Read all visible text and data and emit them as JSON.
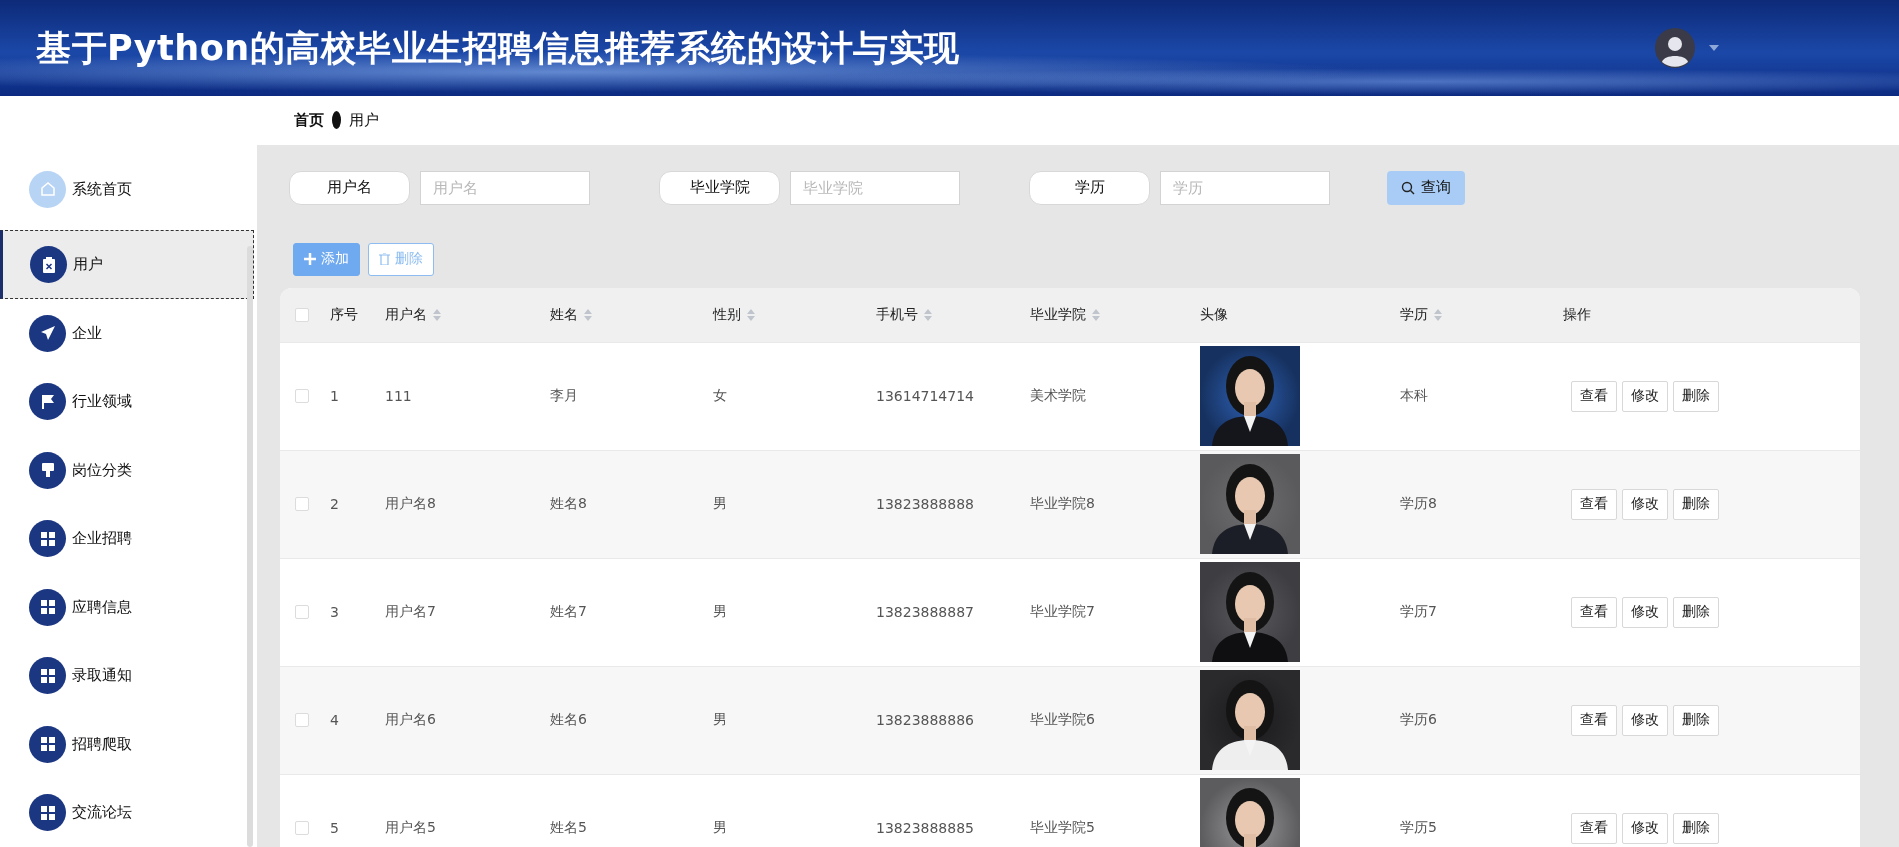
{
  "header": {
    "title": "基于Python的高校毕业生招聘信息推荐系统的设计与实现"
  },
  "breadcrumb": [
    "首页",
    "用户"
  ],
  "sidebar": {
    "items": [
      {
        "label": "系统首页",
        "kind": "home",
        "selected": false
      },
      {
        "label": "用户",
        "kind": "clipboard",
        "selected": true
      },
      {
        "label": "企业",
        "kind": "plane",
        "selected": false
      },
      {
        "label": "行业领域",
        "kind": "flag",
        "selected": false
      },
      {
        "label": "岗位分类",
        "kind": "brush",
        "selected": false
      },
      {
        "label": "企业招聘",
        "kind": "grid",
        "selected": false
      },
      {
        "label": "应聘信息",
        "kind": "grid",
        "selected": false
      },
      {
        "label": "录取通知",
        "kind": "grid",
        "selected": false
      },
      {
        "label": "招聘爬取",
        "kind": "grid",
        "selected": false
      },
      {
        "label": "交流论坛",
        "kind": "grid",
        "selected": false
      }
    ]
  },
  "search": {
    "fields": [
      {
        "label": "用户名",
        "placeholder": "用户名"
      },
      {
        "label": "毕业学院",
        "placeholder": "毕业学院"
      },
      {
        "label": "学历",
        "placeholder": "学历"
      }
    ],
    "button": "查询"
  },
  "actions": [
    {
      "label": "添加",
      "kind": "add"
    },
    {
      "label": "删除",
      "kind": "delete"
    }
  ],
  "table": {
    "header_checked": false,
    "columns": [
      {
        "label": "序号",
        "sortable": false
      },
      {
        "label": "用户名",
        "sortable": true
      },
      {
        "label": "姓名",
        "sortable": true
      },
      {
        "label": "性别",
        "sortable": true
      },
      {
        "label": "手机号",
        "sortable": true
      },
      {
        "label": "毕业学院",
        "sortable": true
      },
      {
        "label": "头像",
        "sortable": false
      },
      {
        "label": "学历",
        "sortable": true
      },
      {
        "label": "操作",
        "sortable": false
      }
    ],
    "rows": [
      {
        "checked": false,
        "cells": [
          "1",
          "111",
          "李月",
          "女",
          "13614714714",
          "美术学院",
          "本科"
        ],
        "actions": [
          "查看",
          "修改",
          "删除"
        ]
      },
      {
        "checked": false,
        "cells": [
          "2",
          "用户名8",
          "姓名8",
          "男",
          "13823888888",
          "毕业学院8",
          "学历8"
        ],
        "actions": [
          "查看",
          "修改",
          "删除"
        ]
      },
      {
        "checked": false,
        "cells": [
          "3",
          "用户名7",
          "姓名7",
          "男",
          "13823888887",
          "毕业学院7",
          "学历7"
        ],
        "actions": [
          "查看",
          "修改",
          "删除"
        ]
      },
      {
        "checked": false,
        "cells": [
          "4",
          "用户名6",
          "姓名6",
          "男",
          "13823888886",
          "毕业学院6",
          "学历6"
        ],
        "actions": [
          "查看",
          "修改",
          "删除"
        ]
      },
      {
        "checked": false,
        "cells": [
          "5",
          "用户名5",
          "姓名5",
          "男",
          "13823888885",
          "毕业学院5",
          "学历5"
        ],
        "actions": [
          "查看",
          "修改",
          "删除"
        ]
      }
    ]
  }
}
